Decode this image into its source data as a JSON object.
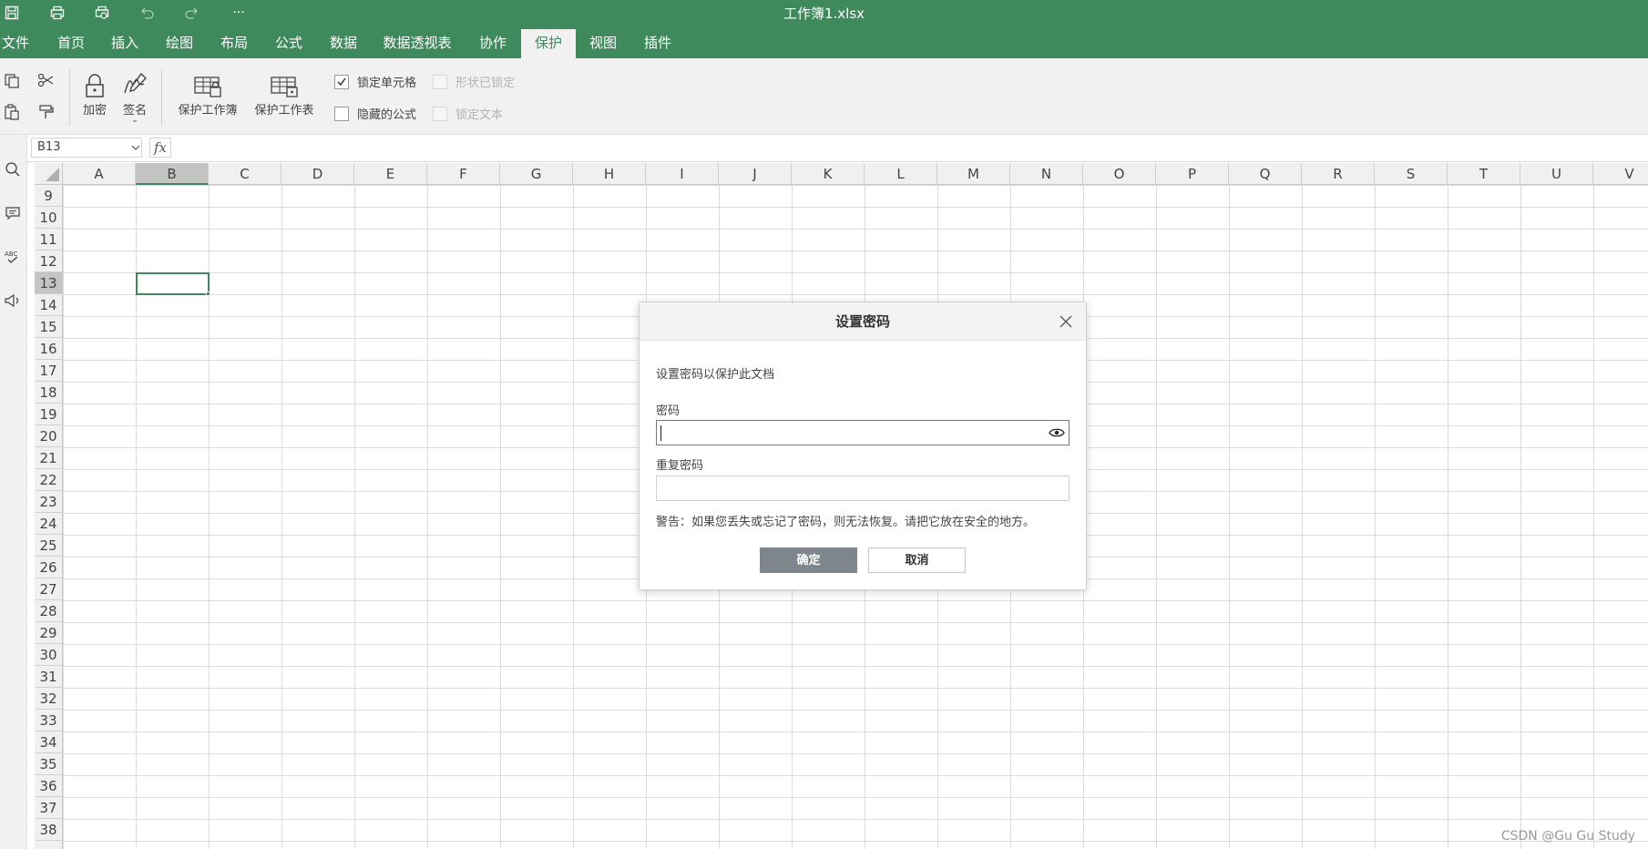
{
  "app": {
    "doc_title": "工作簿1.xlsx",
    "quick_access": [
      "save-icon",
      "print-icon",
      "print-preview-icon",
      "undo-icon",
      "redo-icon",
      "more-icon"
    ],
    "more_label": "···"
  },
  "menu": {
    "items": [
      "文件",
      "首页",
      "插入",
      "绘图",
      "布局",
      "公式",
      "数据",
      "数据透视表",
      "协作",
      "保护",
      "视图",
      "插件"
    ],
    "active": "保护"
  },
  "ribbon": {
    "encrypt_label": "加密",
    "sign_label": "签名",
    "protect_workbook_label": "保护工作簿",
    "protect_sheet_label": "保护工作表",
    "lock_cells_label": "锁定单元格",
    "lock_cells_checked": true,
    "hidden_formula_label": "隐藏的公式",
    "hidden_formula_checked": false,
    "shape_locked_label": "形状已锁定",
    "lock_text_label": "锁定文本"
  },
  "formula_bar": {
    "cell_ref": "B13",
    "fx_label": "fx",
    "content": ""
  },
  "grid": {
    "columns": [
      "A",
      "B",
      "C",
      "D",
      "E",
      "F",
      "G",
      "H",
      "I",
      "J",
      "K",
      "L",
      "M",
      "N",
      "O",
      "P",
      "Q",
      "R",
      "S",
      "T",
      "U",
      "V"
    ],
    "rows": [
      "9",
      "10",
      "11",
      "12",
      "13",
      "14",
      "15",
      "16",
      "17",
      "18",
      "19",
      "20",
      "21",
      "22",
      "23",
      "24",
      "25",
      "26",
      "27",
      "28",
      "29",
      "30",
      "31",
      "32",
      "33",
      "34",
      "35",
      "36",
      "37",
      "38"
    ],
    "selected_column": "B",
    "selected_row": "13"
  },
  "dialog": {
    "title": "设置密码",
    "description": "设置密码以保护此文档",
    "password_label": "密码",
    "password_value": "",
    "repeat_label": "重复密码",
    "repeat_value": "",
    "warning": "警告：如果您丢失或忘记了密码，则无法恢复。请把它放在安全的地方。",
    "ok_label": "确定",
    "cancel_label": "取消"
  },
  "watermark": "CSDN @Gu Gu Study",
  "colors": {
    "accent": "#3f8a5c",
    "ribbon_bg": "#f1f1f1",
    "ok_button": "#7e868c"
  }
}
